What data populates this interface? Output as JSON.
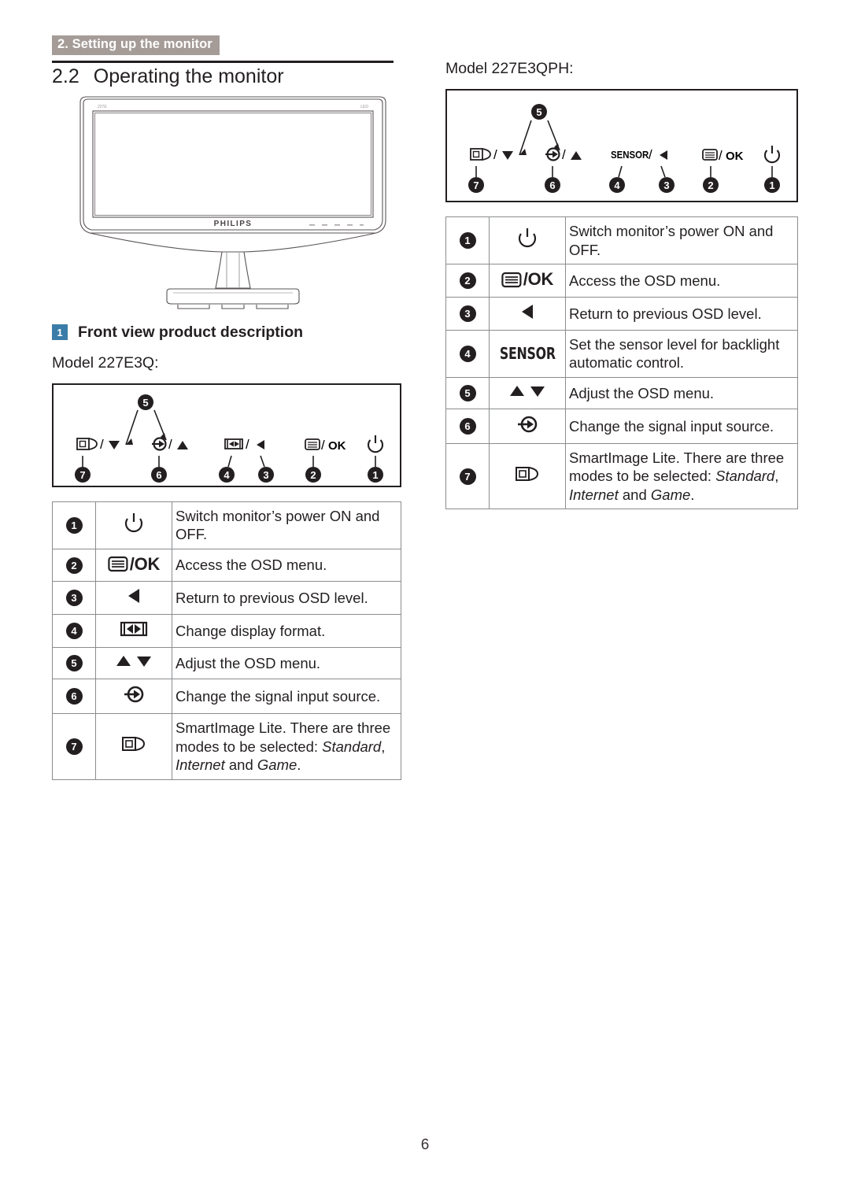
{
  "header": {
    "running_head": "2. Setting up the monitor"
  },
  "section": {
    "number": "2.2",
    "title": "Operating the monitor"
  },
  "front_view": {
    "chip": "1",
    "label": "Front view product description"
  },
  "monitor_image": {
    "brand": "PHILIPS",
    "badge_left": "227E",
    "badge_right": "LED"
  },
  "models": {
    "left": "Model 227E3Q:",
    "right": "Model 227E3QPH:"
  },
  "panel_left": {
    "callouts": [
      {
        "id": "5",
        "glyph": "up-down-arrows"
      },
      {
        "id": "7",
        "glyph": "smartimage-down"
      },
      {
        "id": "6",
        "glyph": "input-up"
      },
      {
        "id": "4",
        "glyph": "display-format"
      },
      {
        "id": "3",
        "glyph": "left-arrow"
      },
      {
        "id": "2",
        "glyph": "menu-ok"
      },
      {
        "id": "1",
        "glyph": "power"
      }
    ],
    "labels": {
      "smartimage": "/",
      "input": "/",
      "format": "/",
      "menu": "/OK"
    }
  },
  "panel_right": {
    "sensor_label": "SENSOR",
    "menu_label": "/OK"
  },
  "table_left": {
    "rows": [
      {
        "num": "1",
        "icon": "power-icon",
        "icon_text": "",
        "text": "Switch monitor’s power ON and OFF."
      },
      {
        "num": "2",
        "icon": "menu-ok-icon",
        "icon_text": "/OK",
        "text": "Access the OSD menu."
      },
      {
        "num": "3",
        "icon": "left-arrow-icon",
        "icon_text": "",
        "text": "Return to previous OSD level."
      },
      {
        "num": "4",
        "icon": "display-format-icon",
        "icon_text": "",
        "text": "Change display format."
      },
      {
        "num": "5",
        "icon": "up-down-arrow-icon",
        "icon_text": "",
        "text": "Adjust the OSD menu."
      },
      {
        "num": "6",
        "icon": "input-source-icon",
        "icon_text": "",
        "text": "Change the signal input source."
      },
      {
        "num": "7",
        "icon": "smartimage-icon",
        "icon_text": "",
        "text_parts": [
          "SmartImage Lite. There are three modes to be selected: ",
          "Standard",
          ", ",
          "Internet",
          " and ",
          "Game",
          "."
        ]
      }
    ]
  },
  "table_right": {
    "rows": [
      {
        "num": "1",
        "icon": "power-icon",
        "icon_text": "",
        "text": "Switch monitor’s power ON and OFF."
      },
      {
        "num": "2",
        "icon": "menu-ok-icon",
        "icon_text": "/OK",
        "text": "Access the OSD menu."
      },
      {
        "num": "3",
        "icon": "left-arrow-icon",
        "icon_text": "",
        "text": "Return to previous OSD level."
      },
      {
        "num": "4",
        "icon": "sensor-text-icon",
        "icon_text": "SENSOR",
        "text": "Set the sensor level for backlight automatic control."
      },
      {
        "num": "5",
        "icon": "up-down-arrow-icon",
        "icon_text": "",
        "text": "Adjust the OSD menu."
      },
      {
        "num": "6",
        "icon": "input-source-icon",
        "icon_text": "",
        "text": "Change the signal input source."
      },
      {
        "num": "7",
        "icon": "smartimage-icon",
        "icon_text": "",
        "text_parts": [
          "SmartImage Lite. There are three modes to be selected: ",
          "Standard",
          ", ",
          "Internet",
          " and ",
          "Game",
          "."
        ]
      }
    ]
  },
  "footer": {
    "page_number": "6"
  },
  "colors": {
    "header_band": "#a59c98",
    "chip_blue": "#3b7ca8",
    "ink": "#231f20",
    "rule": "#231f20",
    "table_border": "#8a8c8e"
  }
}
